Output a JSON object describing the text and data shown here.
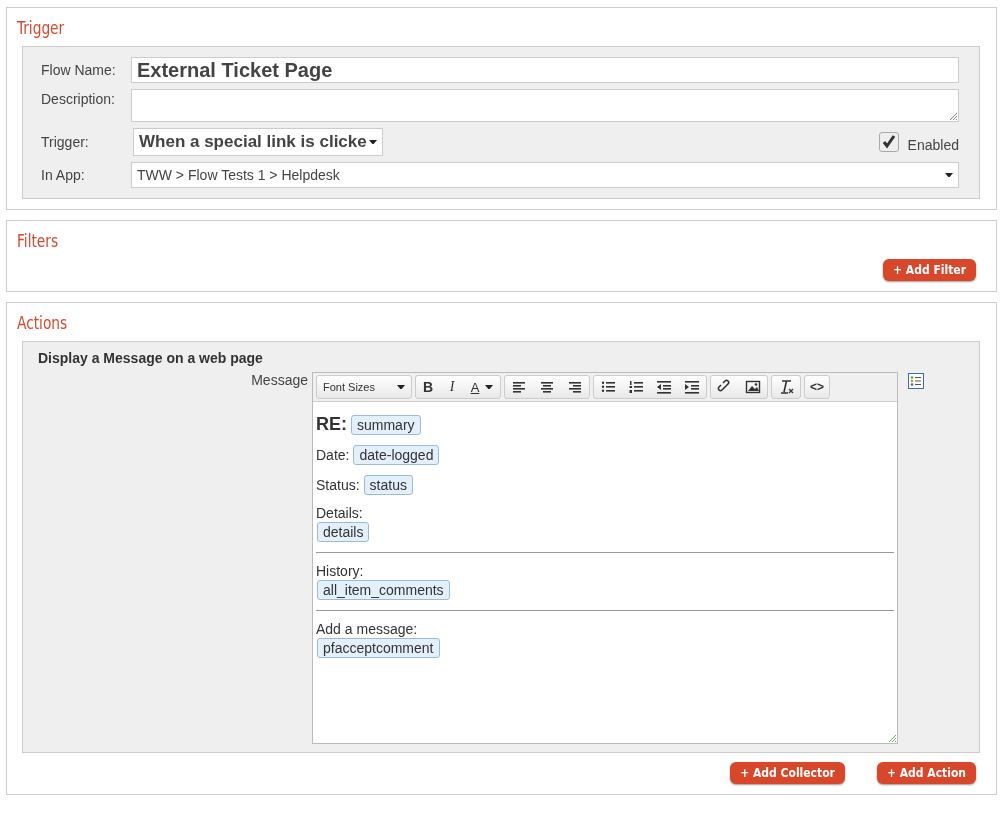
{
  "trigger": {
    "title": "Trigger",
    "fields": [
      {
        "label": "Flow Name:",
        "value": "External Ticket Page"
      },
      {
        "label": "Description:"
      },
      {
        "label": "Trigger:",
        "value": "When a special link is clicke"
      },
      {
        "label": "In App:",
        "value": "TWW > Flow Tests 1 > Helpdesk"
      }
    ],
    "enabled": {
      "label": "Enabled",
      "checked": true
    }
  },
  "filters": {
    "title": "Filters",
    "button": "+ Add Filter"
  },
  "actions": {
    "title": "Actions",
    "action_title": "Display a Message on a web page",
    "message_label": "Message",
    "toolbar": {
      "font_sizes": "Font Sizes",
      "bold": "B",
      "italic": "I",
      "text_color": "A",
      "code": "<>"
    },
    "content": [
      {
        "kind": "heading",
        "text": "RE:",
        "token": "summary"
      },
      {
        "kind": "inline",
        "text": "Date:",
        "token": "date-logged"
      },
      {
        "kind": "inline",
        "text": "Status:",
        "token": "status"
      },
      {
        "kind": "block",
        "text": "Details:",
        "token": "details"
      },
      {
        "kind": "rule"
      },
      {
        "kind": "block",
        "text": "History:",
        "token": "all_item_comments"
      },
      {
        "kind": "rule"
      },
      {
        "kind": "block",
        "text": "Add a message:",
        "token": "pfacceptcomment"
      }
    ],
    "buttons": [
      "+ Add Collector",
      "+ Add Action"
    ]
  }
}
